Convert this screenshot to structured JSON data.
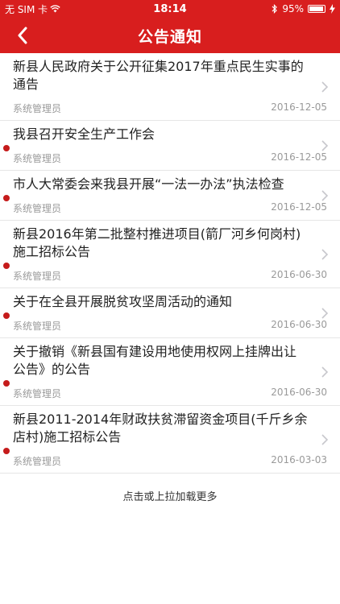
{
  "status": {
    "carrier": "无 SIM 卡",
    "time": "18:14",
    "battery": "95%"
  },
  "nav": {
    "title": "公告通知"
  },
  "notices": [
    {
      "title": "新县人民政府关于公开征集2017年重点民生实事的通告",
      "author": "系统管理员",
      "date": "2016-12-05",
      "unread": false
    },
    {
      "title": "我县召开安全生产工作会",
      "author": "系统管理员",
      "date": "2016-12-05",
      "unread": true
    },
    {
      "title": "市人大常委会来我县开展“一法一办法”执法检查",
      "author": "系统管理员",
      "date": "2016-12-05",
      "unread": true
    },
    {
      "title": "新县2016年第二批整村推进项目(箭厂河乡何岗村)施工招标公告",
      "author": "系统管理员",
      "date": "2016-06-30",
      "unread": true
    },
    {
      "title": "关于在全县开展脱贫攻坚周活动的通知",
      "author": "系统管理员",
      "date": "2016-06-30",
      "unread": true
    },
    {
      "title": "关于撤销《新县国有建设用地使用权网上挂牌出让公告》的公告",
      "author": "系统管理员",
      "date": "2016-06-30",
      "unread": true
    },
    {
      "title": "新县2011-2014年财政扶贫滞留资金项目(千斤乡余店村)施工招标公告",
      "author": "系统管理员",
      "date": "2016-03-03",
      "unread": true
    }
  ],
  "load_more": "点击或上拉加载更多"
}
